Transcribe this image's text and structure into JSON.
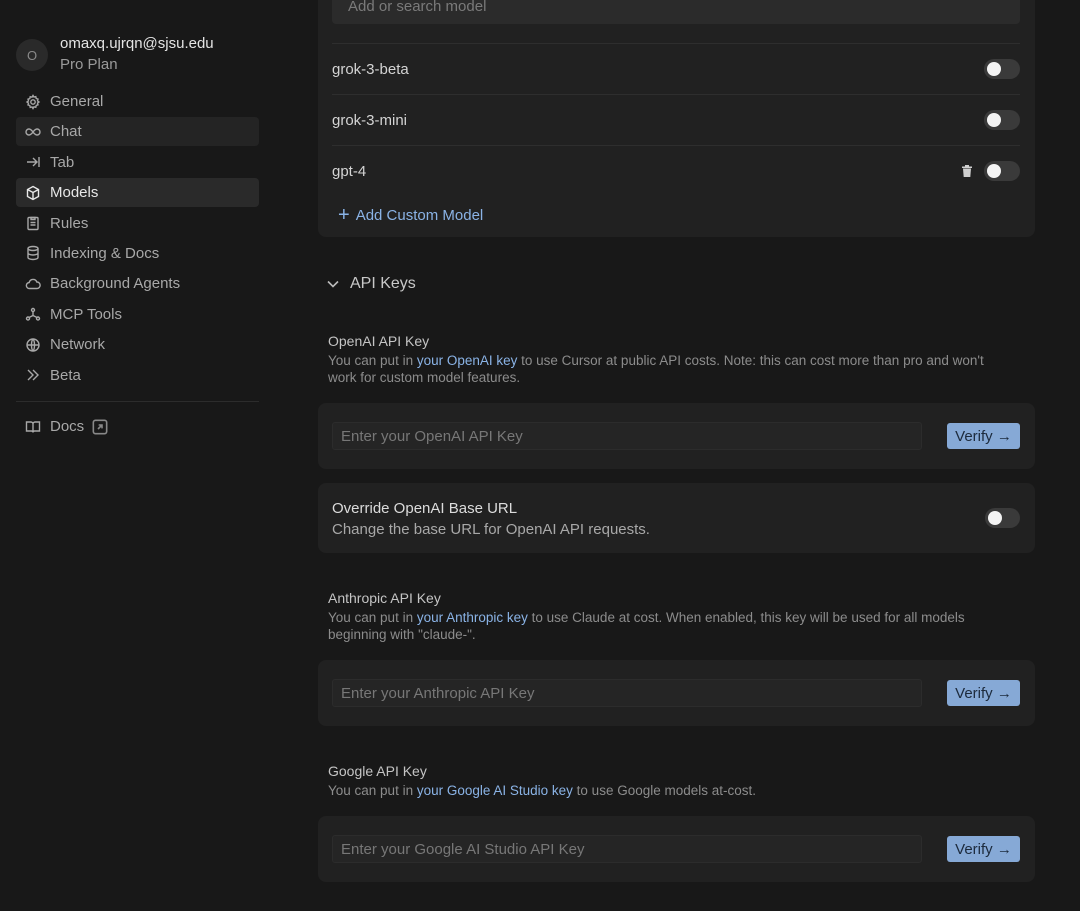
{
  "account": {
    "avatar_initial": "O",
    "email": "omaxq.ujrqn@sjsu.edu",
    "plan": "Pro Plan"
  },
  "nav": [
    {
      "label": "General",
      "icon": "gear-icon"
    },
    {
      "label": "Chat",
      "icon": "infinity-icon"
    },
    {
      "label": "Tab",
      "icon": "arrow-tab-icon"
    },
    {
      "label": "Models",
      "icon": "cube-icon"
    },
    {
      "label": "Rules",
      "icon": "clipboard-icon"
    },
    {
      "label": "Indexing & Docs",
      "icon": "database-icon"
    },
    {
      "label": "Background Agents",
      "icon": "cloud-icon"
    },
    {
      "label": "MCP Tools",
      "icon": "network-nodes-icon"
    },
    {
      "label": "Network",
      "icon": "globe-icon"
    },
    {
      "label": "Beta",
      "icon": "double-chevron-icon"
    }
  ],
  "docs": {
    "label": "Docs",
    "icon": "book-icon"
  },
  "models": {
    "search_placeholder": "Add or search model",
    "rows": [
      {
        "name": "grok-3-beta",
        "enabled": false
      },
      {
        "name": "grok-3-mini",
        "enabled": false
      },
      {
        "name": "gpt-4",
        "enabled": false,
        "deletable": true
      }
    ],
    "add_custom_label": "Add Custom Model"
  },
  "api_keys": {
    "section_title": "API Keys",
    "openai": {
      "label": "OpenAI API Key",
      "desc_pre": "You can put in ",
      "link": "your OpenAI key",
      "desc_post": " to use Cursor at public API costs. Note: this can cost more than pro and won't work for custom model features.",
      "placeholder": "Enter your OpenAI API Key",
      "verify_label": "Verify →"
    },
    "override": {
      "title": "Override OpenAI Base URL",
      "subtitle": "Change the base URL for OpenAI API requests."
    },
    "anthropic": {
      "label": "Anthropic API Key",
      "desc_pre": "You can put in ",
      "link": "your Anthropic key",
      "desc_post": " to use Claude at cost. When enabled, this key will be used for all models beginning with \"claude-\".",
      "placeholder": "Enter your Anthropic API Key",
      "verify_label": "Verify →"
    },
    "google": {
      "label": "Google API Key",
      "desc_pre": "You can put in ",
      "link": "your Google AI Studio key",
      "desc_post": " to use Google models at-cost.",
      "placeholder": "Enter your Google AI Studio API Key",
      "verify_label": "Verify →"
    }
  },
  "colors": {
    "background": "#181818",
    "card": "#212121",
    "accent_link": "#8ab3e6",
    "verify_button": "#86a9d6"
  }
}
